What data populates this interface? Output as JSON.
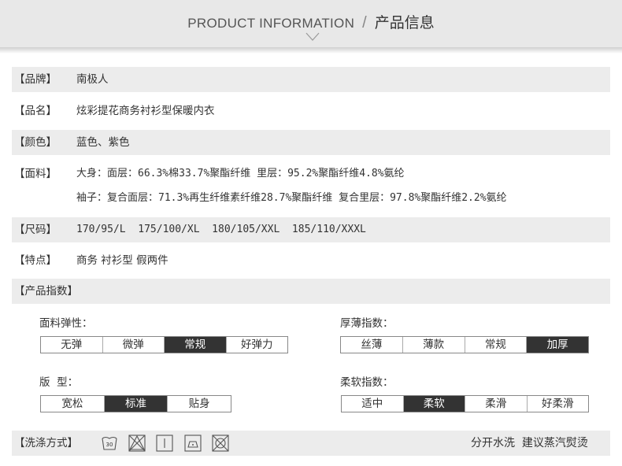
{
  "header": {
    "title_en": "PRODUCT INFORMATION",
    "separator": "/",
    "title_cn": "产品信息"
  },
  "rows": {
    "brand": {
      "label": "【品牌】",
      "value": "南极人"
    },
    "name": {
      "label": "【品名】",
      "value": "炫彩提花商务衬衫型保暖内衣"
    },
    "color": {
      "label": "【颜色】",
      "value": "蓝色、紫色"
    },
    "fabric": {
      "label": "【面料】",
      "line1": "大身：面层：66.3%棉33.7%聚酯纤维 里层：95.2%聚酯纤维4.8%氨纶",
      "line2": "袖子：复合面层：71.3%再生纤维素纤维28.7%聚酯纤维  复合里层：97.8%聚酯纤维2.2%氨纶"
    },
    "size": {
      "label": "【尺码】",
      "value": "170/95/L  175/100/XL  180/105/XXL  185/110/XXXL"
    },
    "features": {
      "label": "【特点】",
      "value": "商务 衬衫型 假两件"
    }
  },
  "index": {
    "title": "【产品指数】",
    "elasticity": {
      "label": "面料弹性：",
      "options": [
        "无弹",
        "微弹",
        "常规",
        "好弹力"
      ],
      "selected": "常规"
    },
    "thickness": {
      "label": "厚薄指数：",
      "options": [
        "丝薄",
        "薄款",
        "常规",
        "加厚"
      ],
      "selected": "加厚"
    },
    "fit": {
      "label": "版  型：",
      "options": [
        "宽松",
        "标准",
        "贴身"
      ],
      "selected": "标准"
    },
    "softness": {
      "label": "柔软指数：",
      "options": [
        "适中",
        "柔软",
        "柔滑",
        "好柔滑"
      ],
      "selected": "柔软"
    }
  },
  "washing": {
    "label": "【洗涤方式】",
    "icons": [
      "wash-30-icon",
      "no-bleach-icon",
      "line-dry-icon",
      "low-iron-icon",
      "no-dry-clean-icon"
    ],
    "wash_temp": "30",
    "text": "分开水洗  建议蒸汽熨烫"
  }
}
